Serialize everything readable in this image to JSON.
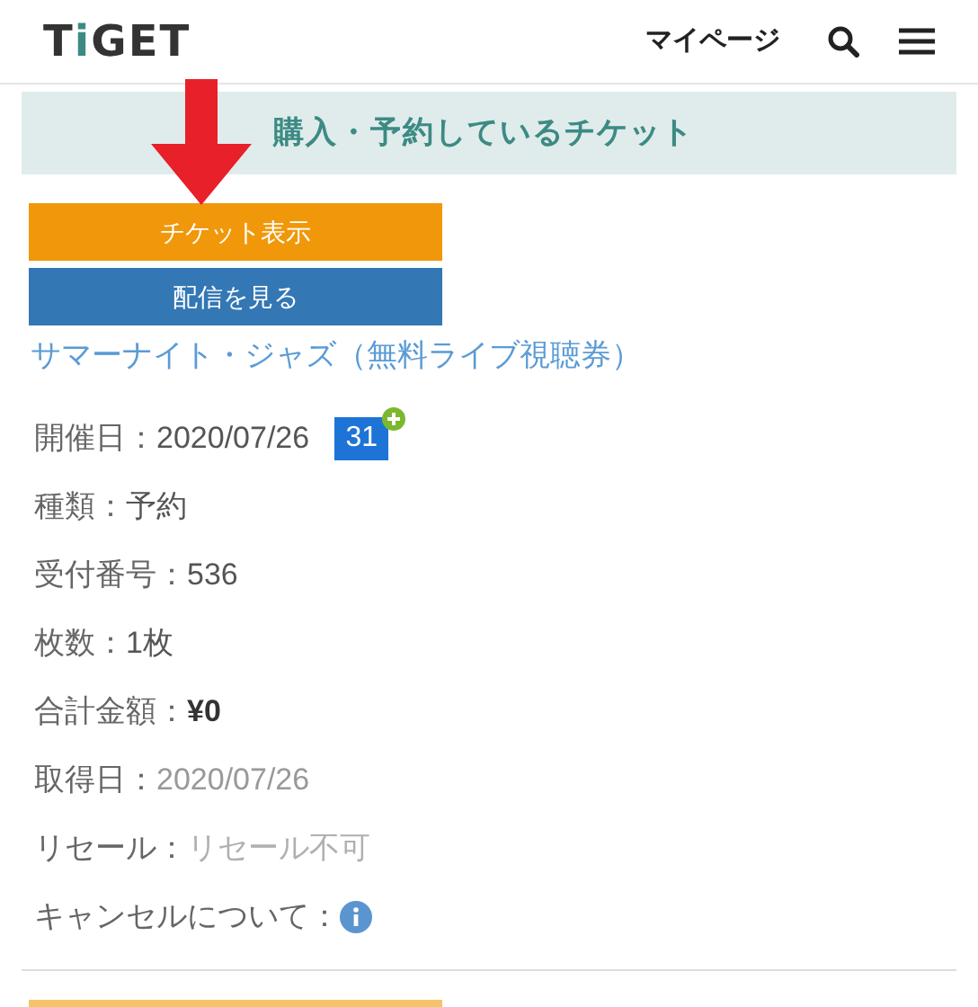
{
  "header": {
    "logo": "TiGET",
    "mypage": "マイページ"
  },
  "section_title": "購入・予約しているチケット",
  "buttons": [
    {
      "label": "チケット表示",
      "kind": "orange"
    },
    {
      "label": "配信を見る",
      "kind": "blue"
    }
  ],
  "event_link": "サマーナイト・ジャズ（無料ライブ視聴券）",
  "details": [
    {
      "label": "開催日：",
      "value": "2020/07/26",
      "kind": "calendar",
      "calendar_day": "31"
    },
    {
      "label": "種類：",
      "value": "予約",
      "kind": "plain"
    },
    {
      "label": "受付番号：",
      "value": "536",
      "kind": "plain"
    },
    {
      "label": "枚数：",
      "value": "1枚",
      "kind": "plain"
    },
    {
      "label": "合計金額：",
      "value": "¥0",
      "kind": "bold"
    },
    {
      "label": "取得日：",
      "value": "2020/07/26",
      "kind": "muted"
    },
    {
      "label": "リセール：",
      "value": "リセール不可",
      "kind": "faint"
    },
    {
      "label": "キャンセルについて：",
      "kind": "info"
    }
  ]
}
